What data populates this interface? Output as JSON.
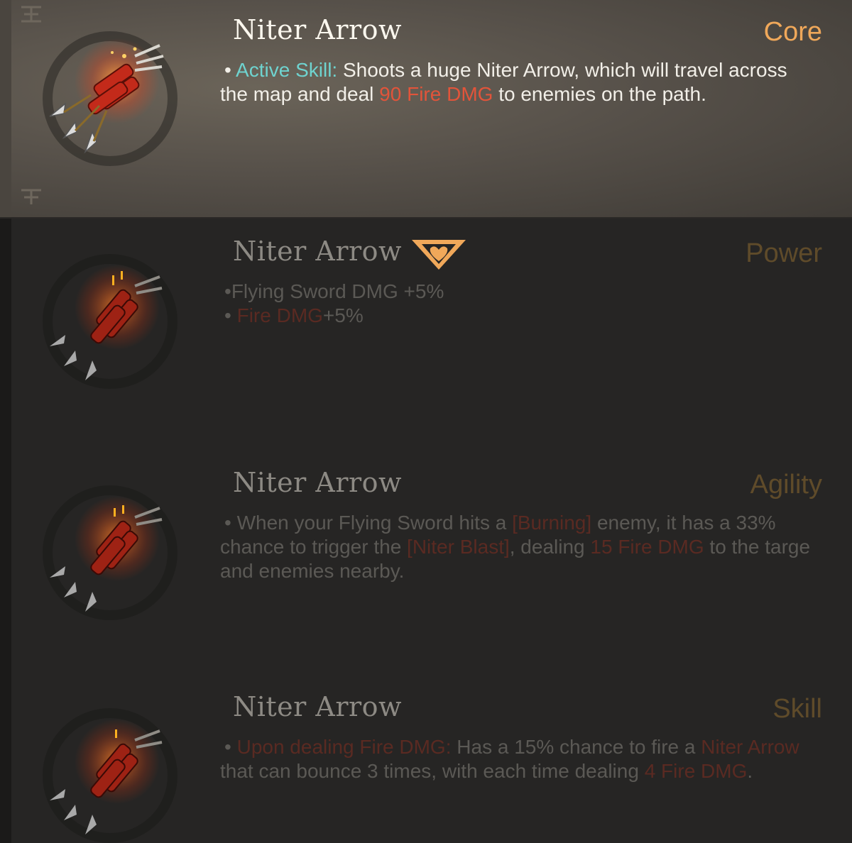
{
  "cards": [
    {
      "title": "Niter Arrow",
      "category": "Core",
      "lines": [
        {
          "bullet": "•",
          "label": "Active Skill:",
          "text1": " Shoots a huge Niter Arrow, which will travel across"
        },
        {
          "text1": "the map and deal ",
          "fire": "90 Fire DMG",
          "text2": " to enemies on the path."
        }
      ]
    },
    {
      "title": "Niter Arrow",
      "category": "Power",
      "lines": [
        {
          "bullet": "•",
          "text1": "Flying Sword DMG +5%"
        },
        {
          "bullet": "•",
          "fire": "Fire DMG",
          "text2": "+5%"
        }
      ]
    },
    {
      "title": "Niter Arrow",
      "category": "Agility",
      "lines": [
        {
          "bullet": "•",
          "text1": " When your Flying Sword hits a ",
          "fire": "[Burning]",
          "text2": " enemy, it has a 33%"
        },
        {
          "text1": "chance to trigger the ",
          "fire": "[Niter Blast]",
          "text2": ", dealing ",
          "fire2": "15 Fire DMG",
          "text3": " to the targe"
        },
        {
          "text1": "and enemies nearby."
        }
      ]
    },
    {
      "title": "Niter Arrow",
      "category": "Skill",
      "lines": [
        {
          "bullet": "•",
          "fire": " Upon dealing Fire DMG:",
          "text2": " Has a 15% chance to fire a ",
          "fire2": "Niter Arrow"
        },
        {
          "text1": "that can bounce 3 times, with each time dealing ",
          "fire": "4 Fire DMG",
          "text2": "."
        }
      ]
    }
  ],
  "icons": {
    "item": "niter-arrow-bundle-icon",
    "badge": "heart-chevron-badge-icon",
    "corner": "rune-mark-icon"
  },
  "colors": {
    "skill_label": "#6fd3cf",
    "fire": "#e2543a",
    "category_active": "#f0a85a",
    "title_active": "#fbf7ee"
  }
}
